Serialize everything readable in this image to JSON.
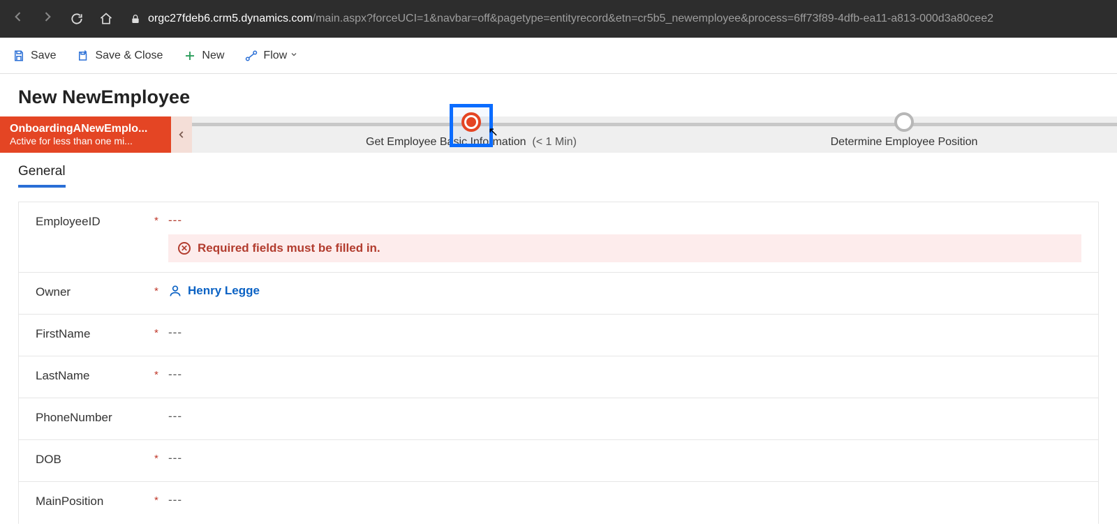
{
  "browser": {
    "url_host": "orgc27fdeb6.crm5.dynamics.com",
    "url_path": "/main.aspx?forceUCI=1&navbar=off&pagetype=entityrecord&etn=cr5b5_newemployee&process=6ff73f89-4dfb-ea11-a813-000d3a80cee2"
  },
  "commands": {
    "save": "Save",
    "save_close": "Save & Close",
    "new": "New",
    "flow": "Flow"
  },
  "page": {
    "title": "New NewEmployee"
  },
  "bpf": {
    "process_name": "OnboardingANewEmplo...",
    "process_status": "Active for less than one mi...",
    "stages": [
      {
        "label": "Get Employee Basic Information",
        "duration": "(< 1 Min)",
        "active": true
      },
      {
        "label": "Determine Employee Position",
        "duration": "",
        "active": false
      }
    ]
  },
  "tabs": [
    {
      "label": "General",
      "active": true
    }
  ],
  "form": {
    "error_message": "Required fields must be filled in.",
    "empty": "---",
    "fields": {
      "employee_id": {
        "label": "EmployeeID",
        "required": true,
        "value": "---",
        "has_error": true
      },
      "owner": {
        "label": "Owner",
        "required": true,
        "value": "Henry Legge",
        "is_lookup": true
      },
      "first_name": {
        "label": "FirstName",
        "required": true,
        "value": "---"
      },
      "last_name": {
        "label": "LastName",
        "required": true,
        "value": "---"
      },
      "phone_number": {
        "label": "PhoneNumber",
        "required": false,
        "value": "---"
      },
      "dob": {
        "label": "DOB",
        "required": true,
        "value": "---"
      },
      "main_position": {
        "label": "MainPosition",
        "required": true,
        "value": "---"
      }
    }
  }
}
